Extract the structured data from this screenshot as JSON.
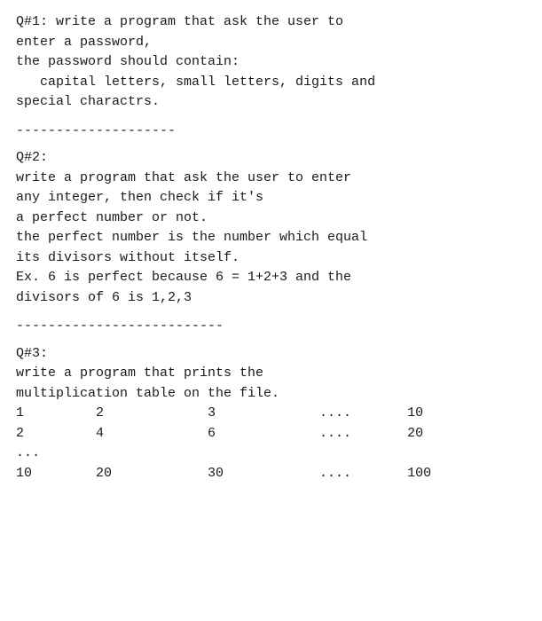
{
  "questions": [
    {
      "id": "q1",
      "lines": [
        "Q#1: write a program that ask the user to",
        "enter a password,",
        "the password should contain:",
        "   capital letters, small letters, digits and",
        "special charactrs."
      ]
    },
    {
      "id": "q2",
      "divider": "--------------------",
      "lines": [
        "Q#2:",
        "write a program that ask the user to enter",
        "any integer, then check if it's",
        "a perfect number or not.",
        "the perfect number is the number which equal",
        "its divisors without itself.",
        "Ex. 6 is perfect because 6 = 1+2+3 and the",
        "divisors of 6 is 1,2,3"
      ]
    },
    {
      "id": "q3",
      "divider": "--------------------------",
      "lines": [
        "Q#3:",
        "write a program that prints the",
        "multiplication table on the file."
      ],
      "table": {
        "rows": [
          {
            "cols": [
              "1",
              "2",
              "3",
              "....",
              "10"
            ]
          },
          {
            "cols": [
              "2",
              "4",
              "6",
              "....",
              "20"
            ]
          },
          {
            "cols": [
              "..."
            ]
          },
          {
            "cols": [
              "10",
              "20",
              "30",
              "....",
              "100"
            ]
          }
        ]
      }
    }
  ]
}
